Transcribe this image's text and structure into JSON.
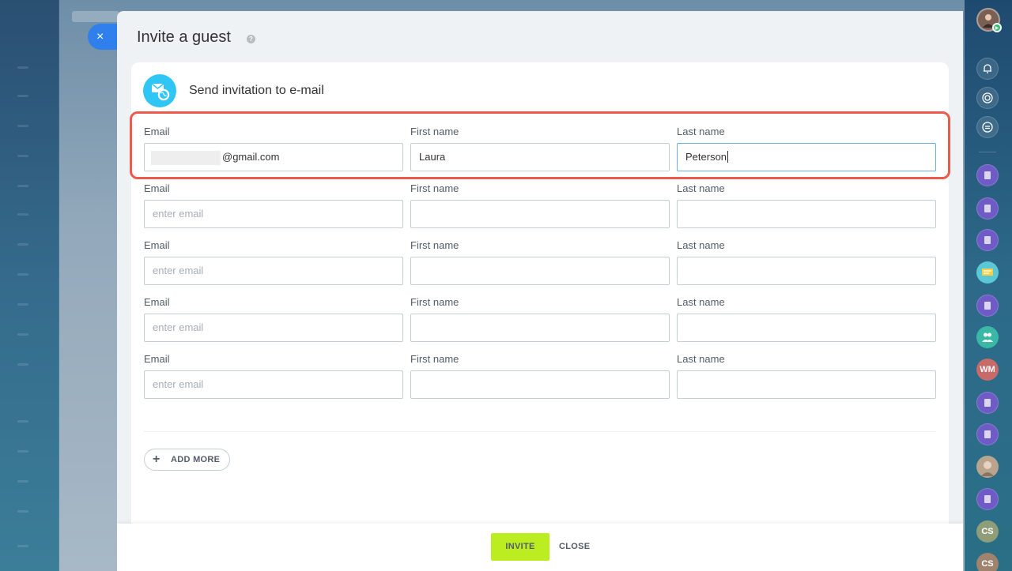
{
  "panel": {
    "title": "Invite a guest",
    "help_icon": "?",
    "close_icon": "×"
  },
  "card": {
    "heading": "Send invitation to e-mail",
    "icon": "email-globe-icon"
  },
  "labels": {
    "email": "Email",
    "first_name": "First name",
    "last_name": "Last name"
  },
  "rows": [
    {
      "email": "@gmail.com",
      "email_placeholder": "",
      "first_name": "Laura",
      "last_name": "Peterson"
    },
    {
      "email": "",
      "email_placeholder": "enter email",
      "first_name": "",
      "last_name": ""
    },
    {
      "email": "",
      "email_placeholder": "enter email",
      "first_name": "",
      "last_name": ""
    },
    {
      "email": "",
      "email_placeholder": "enter email",
      "first_name": "",
      "last_name": ""
    },
    {
      "email": "",
      "email_placeholder": "enter email",
      "first_name": "",
      "last_name": ""
    }
  ],
  "actions": {
    "add_more": "ADD MORE",
    "invite": "INVITE",
    "close": "CLOSE"
  },
  "right_bar": {
    "avatars": [
      "WM",
      "CS",
      "CS"
    ]
  },
  "colors": {
    "accent_blue": "#2f80ed",
    "invite_green": "#bbed21",
    "highlight_red": "#ec5a4b",
    "card_icon": "#2fc6f6"
  }
}
